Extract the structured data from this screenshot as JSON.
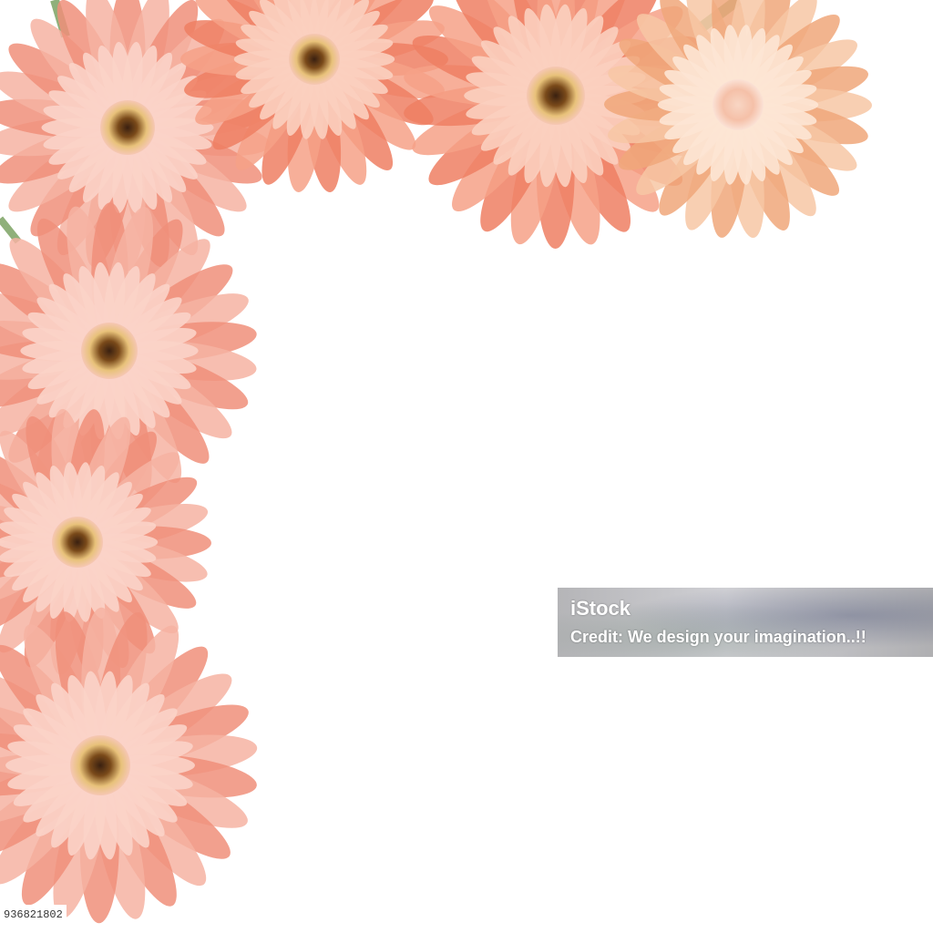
{
  "watermark": {
    "brand": "iStock",
    "credit": "Credit: We design your imagination..!!"
  },
  "stock_id": "936821802",
  "scene": {
    "background": "#ffffff",
    "petal_colors": [
      "#f7a98f",
      "#f9c0b0",
      "#fbd9cf",
      "#f4b58a"
    ],
    "flowers": [
      {
        "name": "gerbera-top-left",
        "tone": "pink"
      },
      {
        "name": "gerbera-top-center",
        "tone": "coral"
      },
      {
        "name": "gerbera-top-right-center",
        "tone": "coral"
      },
      {
        "name": "gerbera-top-right",
        "tone": "peach"
      },
      {
        "name": "gerbera-left-upper",
        "tone": "pink"
      },
      {
        "name": "gerbera-left-middle",
        "tone": "pink"
      },
      {
        "name": "gerbera-left-lower",
        "tone": "pink"
      }
    ]
  }
}
